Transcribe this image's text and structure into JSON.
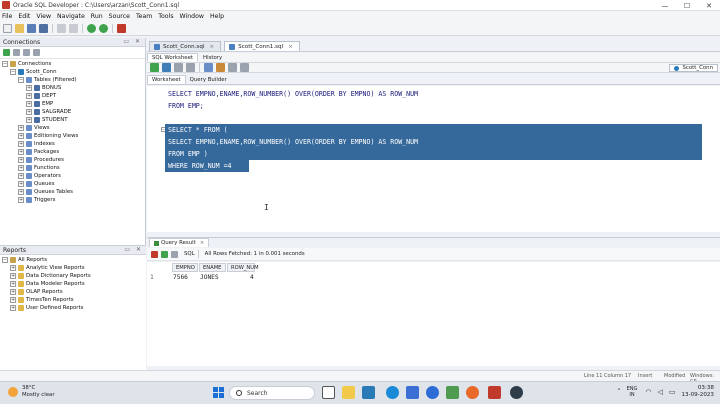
{
  "window": {
    "title": "Oracle SQL Developer : C:\\Users\\arzan\\Scott_Conn1.sql",
    "minimize": "—",
    "maximize": "☐",
    "close": "✕"
  },
  "menu": [
    "File",
    "Edit",
    "View",
    "Navigate",
    "Run",
    "Source",
    "Team",
    "Tools",
    "Window",
    "Help"
  ],
  "connections_panel": {
    "title": "Connections",
    "tree": [
      {
        "label": "Connections",
        "level": 0,
        "exp": "−"
      },
      {
        "label": "Scott_Conn",
        "level": 1,
        "exp": "−"
      },
      {
        "label": "Tables (Filtered)",
        "level": 2,
        "exp": "−"
      },
      {
        "label": "BONUS",
        "level": 3,
        "exp": "+"
      },
      {
        "label": "DEPT",
        "level": 3,
        "exp": "+"
      },
      {
        "label": "EMP",
        "level": 3,
        "exp": "+"
      },
      {
        "label": "SALGRADE",
        "level": 3,
        "exp": "+"
      },
      {
        "label": "STUDENT",
        "level": 3,
        "exp": "+"
      },
      {
        "label": "Views",
        "level": 2,
        "exp": "+"
      },
      {
        "label": "Editioning Views",
        "level": 2,
        "exp": "+"
      },
      {
        "label": "Indexes",
        "level": 2,
        "exp": "+"
      },
      {
        "label": "Packages",
        "level": 2,
        "exp": "+"
      },
      {
        "label": "Procedures",
        "level": 2,
        "exp": "+"
      },
      {
        "label": "Functions",
        "level": 2,
        "exp": "+"
      },
      {
        "label": "Operators",
        "level": 2,
        "exp": "+"
      },
      {
        "label": "Queues",
        "level": 2,
        "exp": "+"
      },
      {
        "label": "Queues Tables",
        "level": 2,
        "exp": "+"
      },
      {
        "label": "Triggers",
        "level": 2,
        "exp": "+"
      }
    ]
  },
  "reports_panel": {
    "title": "Reports",
    "items": [
      {
        "label": "All Reports",
        "level": 0,
        "exp": "−"
      },
      {
        "label": "Analytic View Reports",
        "level": 1,
        "exp": "+"
      },
      {
        "label": "Data Dictionary Reports",
        "level": 1,
        "exp": "+"
      },
      {
        "label": "Data Modeler Reports",
        "level": 1,
        "exp": "+"
      },
      {
        "label": "OLAP Reports",
        "level": 1,
        "exp": "+"
      },
      {
        "label": "TimesTen Reports",
        "level": 1,
        "exp": "+"
      },
      {
        "label": "User Defined Reports",
        "level": 1,
        "exp": "+"
      }
    ]
  },
  "doc_tabs": [
    {
      "label": "Scott_Conn.sql",
      "active": false
    },
    {
      "label": "Scott_Conn1.sql",
      "active": true
    }
  ],
  "sub_tabs": [
    "SQL Worksheet",
    "History"
  ],
  "connection_selector": "Scott_Conn",
  "worksheet_tabs": [
    "Worksheet",
    "Query Builder"
  ],
  "editor": {
    "lines": [
      {
        "text": "SELECT EMPNO,ENAME,ROW_NUMBER() OVER(ORDER BY EMPNO) AS ROW_NUM",
        "selected": false
      },
      {
        "text": "FROM EMP;",
        "selected": false
      },
      {
        "text": "",
        "selected": false
      },
      {
        "text": "SELECT * FROM (",
        "selected": true
      },
      {
        "text": "SELECT EMPNO,ENAME,ROW_NUMBER() OVER(ORDER BY EMPNO) AS ROW_NUM",
        "selected": true
      },
      {
        "text": "FROM EMP )",
        "selected": true
      },
      {
        "text": "WHERE ROW_NUM =4",
        "selected": true
      }
    ],
    "cursor": "I"
  },
  "results": {
    "tab_label": "Query Result",
    "close": "×",
    "sql_label": "SQL",
    "status": "All Rows Fetched: 1 in 0.001 seconds",
    "columns": [
      "EMPNO",
      "ENAME",
      "ROW_NUM"
    ],
    "rows": [
      {
        "rownum": "1",
        "empno": "7566",
        "ename": "JONES",
        "row_num": "4"
      }
    ]
  },
  "statusbar": {
    "position": "Line 11 Column 17",
    "mode": "Insert",
    "modified": "Modified",
    "eol": "Windows: CR"
  },
  "taskbar": {
    "temp": "38°C",
    "weather": "Mostly clear",
    "search": "Search",
    "lang1": "ENG",
    "lang2": "IN",
    "time": "03:38",
    "date": "13-09-2023",
    "colors": {
      "start": "#1d6fd6",
      "oracle": "#c0392b"
    }
  }
}
